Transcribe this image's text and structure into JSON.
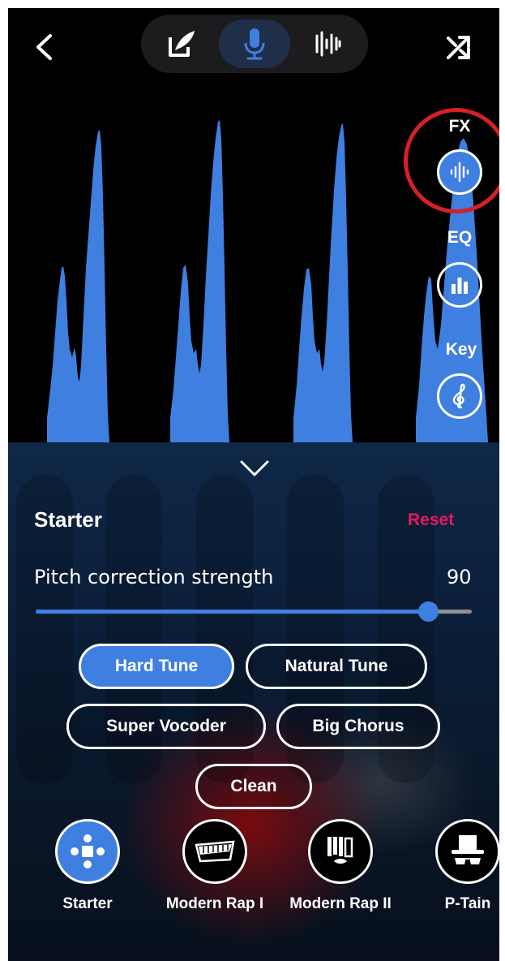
{
  "sidebar": {
    "fx_label": "FX",
    "eq_label": "EQ",
    "key_label": "Key"
  },
  "panel": {
    "preset_title": "Starter",
    "reset_label": "Reset",
    "strength_label": "Pitch correction strength",
    "strength_value": "90",
    "strength_fraction": 0.9,
    "effects": [
      {
        "label": "Hard Tune",
        "active": true
      },
      {
        "label": "Natural Tune",
        "active": false
      },
      {
        "label": "Super Vocoder",
        "active": false
      },
      {
        "label": "Big Chorus",
        "active": false
      },
      {
        "label": "Clean",
        "active": false
      }
    ],
    "presets": [
      {
        "label": "Starter",
        "icon": "starter-dpad-icon",
        "active": true
      },
      {
        "label": "Modern Rap I",
        "icon": "modern-rap-1-icon",
        "active": false
      },
      {
        "label": "Modern Rap II",
        "icon": "modern-rap-2-icon",
        "active": false
      },
      {
        "label": "P-Tain",
        "icon": "top-hat-icon",
        "active": false
      }
    ]
  },
  "colors": {
    "accent": "#3f7fe0",
    "reset": "#e8175d",
    "highlight": "#d81f26",
    "background": "#000000"
  }
}
